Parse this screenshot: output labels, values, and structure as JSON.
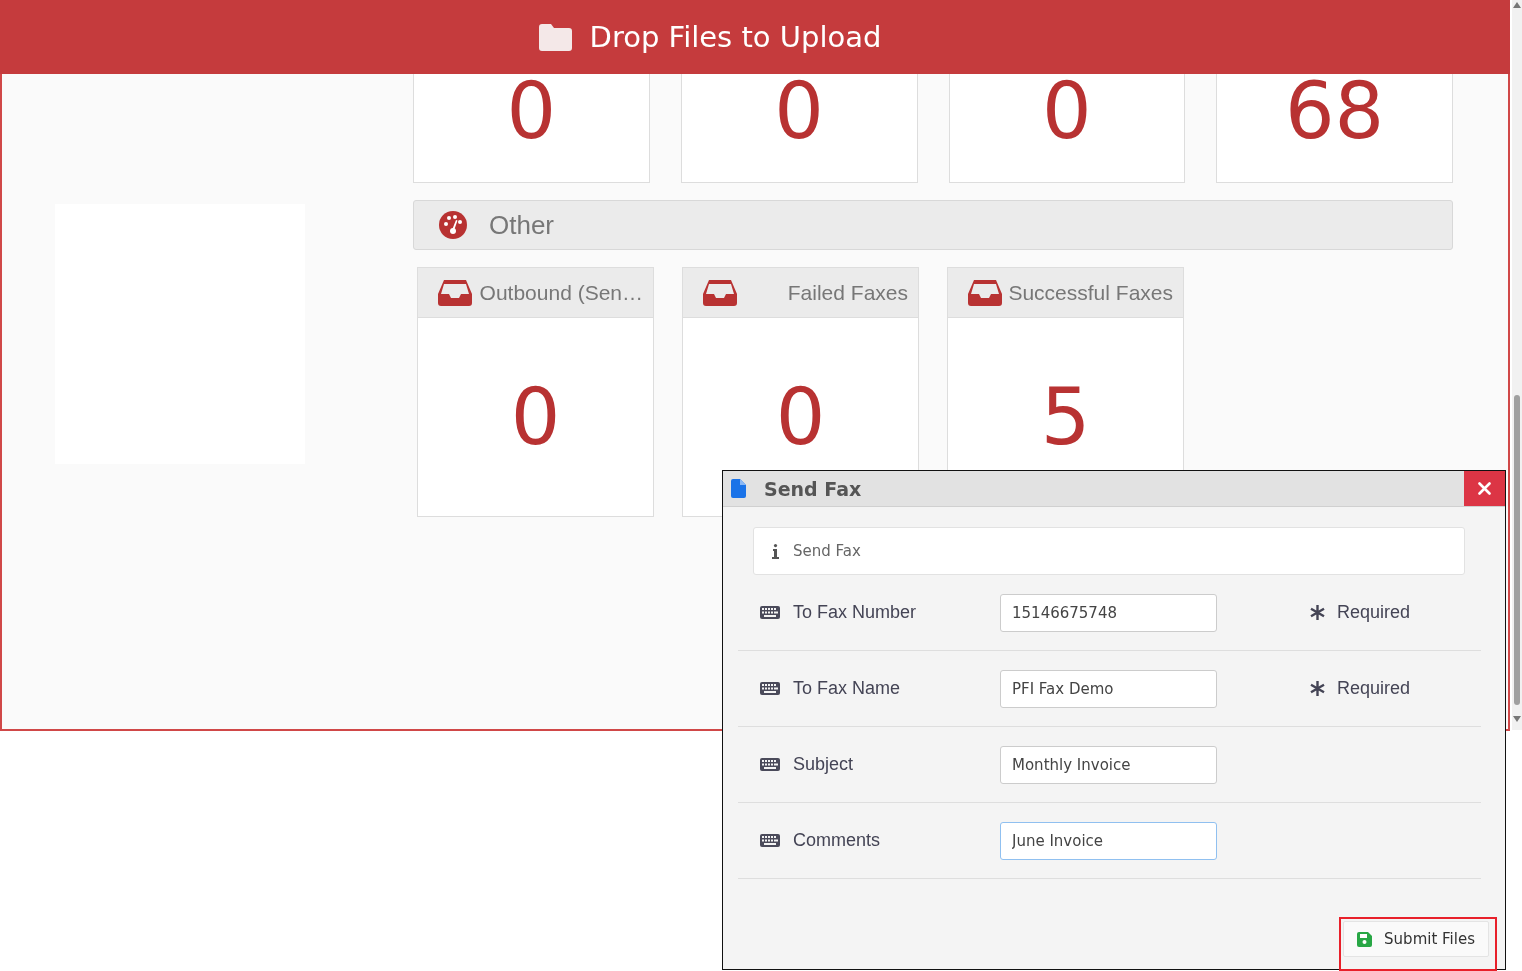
{
  "upload_banner": {
    "label": "Drop Files to Upload"
  },
  "top_counts": [
    "0",
    "0",
    "0",
    "68"
  ],
  "section": {
    "title": "Other"
  },
  "tiles": [
    {
      "title": "Outbound (Sen…",
      "count": "0"
    },
    {
      "title": "Failed Faxes",
      "count": "0"
    },
    {
      "title": "Successful Faxes",
      "count": "5"
    }
  ],
  "dialog": {
    "title": "Send Fax",
    "info": "Send Fax",
    "fields": [
      {
        "label": "To Fax Number",
        "value": "15146675748",
        "note": "Required",
        "focused": false
      },
      {
        "label": "To Fax Name",
        "value": "PFI Fax Demo",
        "note": "Required",
        "focused": false
      },
      {
        "label": "Subject",
        "value": "Monthly Invoice",
        "focused": false
      },
      {
        "label": "Comments",
        "value": "June Invoice",
        "focused": true
      }
    ],
    "submit": "Submit Files"
  }
}
